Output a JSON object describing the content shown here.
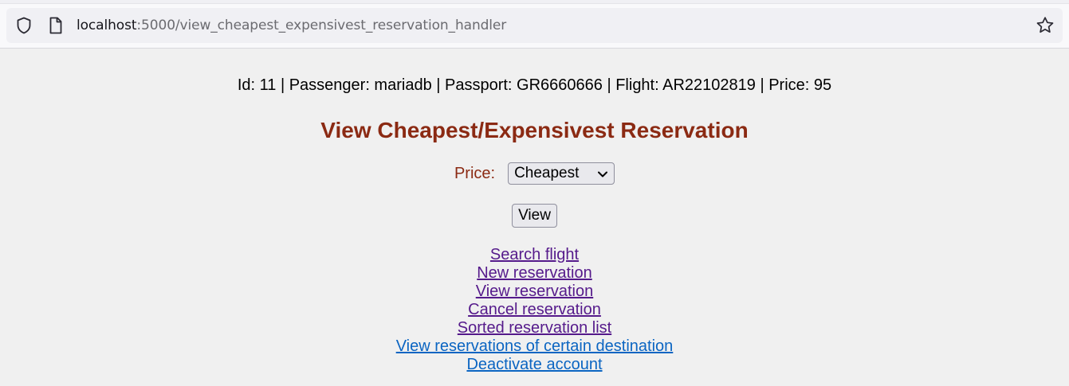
{
  "browser": {
    "url_host": "localhost",
    "url_path": ":5000/view_cheapest_expensivest_reservation_handler"
  },
  "info_line": "Id: 11 | Passenger: mariadb | Passport: GR6660666 | Flight: AR22102819 | Price: 95",
  "heading": "View Cheapest/Expensivest Reservation",
  "form": {
    "price_label": "Price:",
    "price_selected": "Cheapest",
    "view_button": "View"
  },
  "links": [
    {
      "label": "Search flight"
    },
    {
      "label": "New reservation"
    },
    {
      "label": "View reservation"
    },
    {
      "label": "Cancel reservation"
    },
    {
      "label": "Sorted reservation list"
    },
    {
      "label": "View reservations of certain destination"
    },
    {
      "label": "Deactivate account"
    }
  ],
  "colors": {
    "heading": "#8b2a13",
    "visited_link": "#551a8b",
    "unvisited_link": "#0b65c2"
  },
  "icons": [
    "shield-icon",
    "page-icon",
    "star-icon",
    "chevron-down-icon"
  ]
}
